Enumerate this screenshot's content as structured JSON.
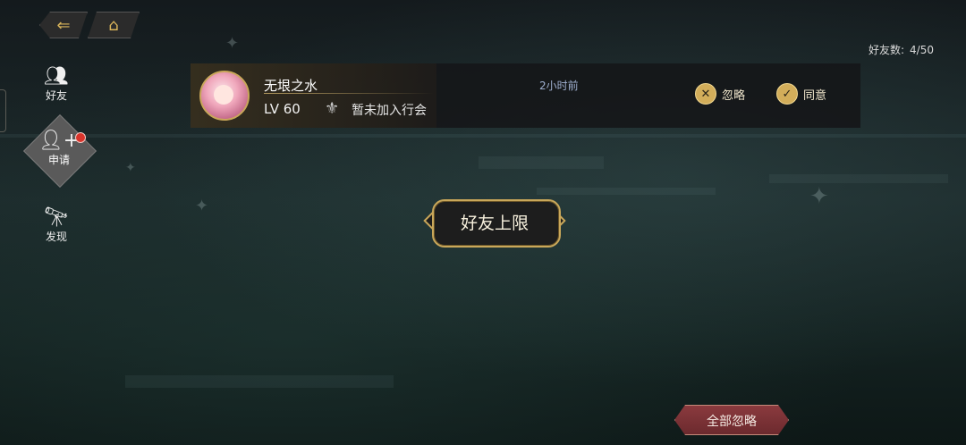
{
  "header": {
    "back_icon": "back-arrow-icon",
    "home_icon": "home-icon",
    "friend_count_label": "好友数:",
    "friend_count_value": "4/50"
  },
  "sidebar": {
    "items": [
      {
        "label": "好友",
        "icon": "friends-icon"
      },
      {
        "label": "申请",
        "icon": "add-friend-icon",
        "active": true,
        "has_badge": true
      },
      {
        "label": "发现",
        "icon": "telescope-icon"
      }
    ]
  },
  "request": {
    "name": "无垠之水",
    "level": "LV 60",
    "guild": "暂未加入行会",
    "time": "2小时前",
    "ignore_label": "忽略",
    "agree_label": "同意"
  },
  "center_badge": {
    "text": "好友上限"
  },
  "footer": {
    "ignore_all_label": "全部忽略"
  },
  "colors": {
    "accent_gold": "#c9a75a",
    "ignore_all_red": "#7a3034",
    "time_blue": "#9fb0d0"
  }
}
